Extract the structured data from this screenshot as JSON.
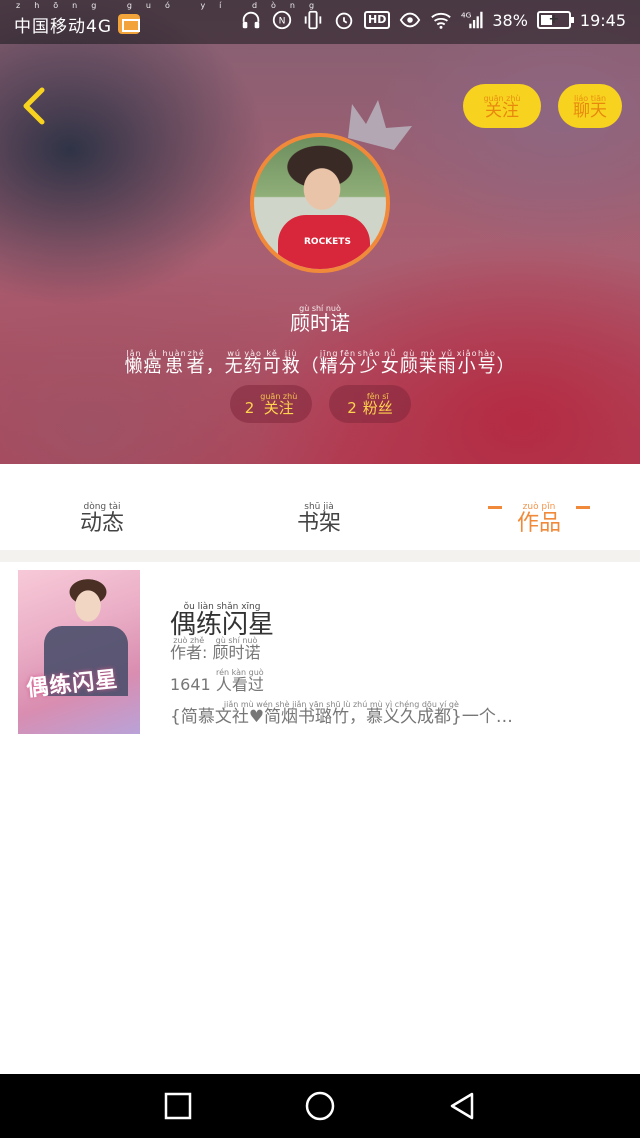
{
  "status_bar": {
    "carrier": "中国移动4G",
    "carrier_pinyin": "zhōng guó yí dòng",
    "battery_percent": "38%",
    "battery_level": 0.38,
    "time": "19:45",
    "signal_label": "4G",
    "hd_label": "HD"
  },
  "header": {
    "follow_btn": {
      "text": "关注",
      "pinyin": "guān zhù"
    },
    "chat_btn": {
      "text": "聊天",
      "pinyin": "liáo tiān"
    }
  },
  "profile": {
    "name": {
      "text": "顾时诺",
      "pinyin": "gù shí nuò"
    },
    "bio": [
      {
        "hz": "懒",
        "py": "lǎn"
      },
      {
        "hz": "癌",
        "py": "ái"
      },
      {
        "hz": "患",
        "py": "huàn"
      },
      {
        "hz": "者",
        "py": "zhě"
      },
      {
        "hz": "，",
        "py": ""
      },
      {
        "hz": "无",
        "py": "wú"
      },
      {
        "hz": "药",
        "py": "yào"
      },
      {
        "hz": "可",
        "py": "kě"
      },
      {
        "hz": "救",
        "py": "jiù"
      },
      {
        "hz": "（",
        "py": ""
      },
      {
        "hz": "精",
        "py": "jīng"
      },
      {
        "hz": "分",
        "py": "fēn"
      },
      {
        "hz": "少",
        "py": "shǎo"
      },
      {
        "hz": "女",
        "py": "nǚ"
      },
      {
        "hz": "顾",
        "py": "gù"
      },
      {
        "hz": "茉",
        "py": "mò"
      },
      {
        "hz": "雨",
        "py": "yǔ"
      },
      {
        "hz": "小",
        "py": "xiǎo"
      },
      {
        "hz": "号",
        "py": "hào"
      },
      {
        "hz": "）",
        "py": ""
      }
    ],
    "following": {
      "count": "2",
      "label": "关注",
      "pinyin": "guān zhù"
    },
    "fans": {
      "count": "2",
      "label": "粉丝",
      "pinyin": "fěn sī"
    }
  },
  "tabs": [
    {
      "label": "动态",
      "pinyin": "dòng tài"
    },
    {
      "label": "书架",
      "pinyin": "shū jià"
    },
    {
      "label": "作品",
      "pinyin": "zuò pǐn"
    }
  ],
  "book": {
    "cover_title": "偶练闪星",
    "title": {
      "text": "偶练闪星",
      "pinyin": "ǒu liàn shǎn xīng"
    },
    "author_label": {
      "text": "作者",
      "pinyin": "zuò zhě"
    },
    "author": {
      "text": "顾时诺",
      "pinyin": "gù shí nuò"
    },
    "views_count": "1641",
    "views_label": {
      "text": "人看过",
      "pinyin": "rén kàn guò"
    },
    "description": "{简慕文社♥简烟书璐竹，慕义久成都}一个…",
    "description_pinyin": "jiǎn mù wén shè jiǎn yān shū lù zhú mù yì chéng dōu yí gè"
  },
  "colors": {
    "accent_orange": "#f08a3a",
    "button_yellow": "#f7d21f",
    "stat_text": "#ffd34d"
  },
  "icons": {
    "back": "chevron-left-icon",
    "crown": "crown-icon",
    "nav_recent": "square-icon",
    "nav_home": "circle-icon",
    "nav_back": "triangle-back-icon"
  }
}
